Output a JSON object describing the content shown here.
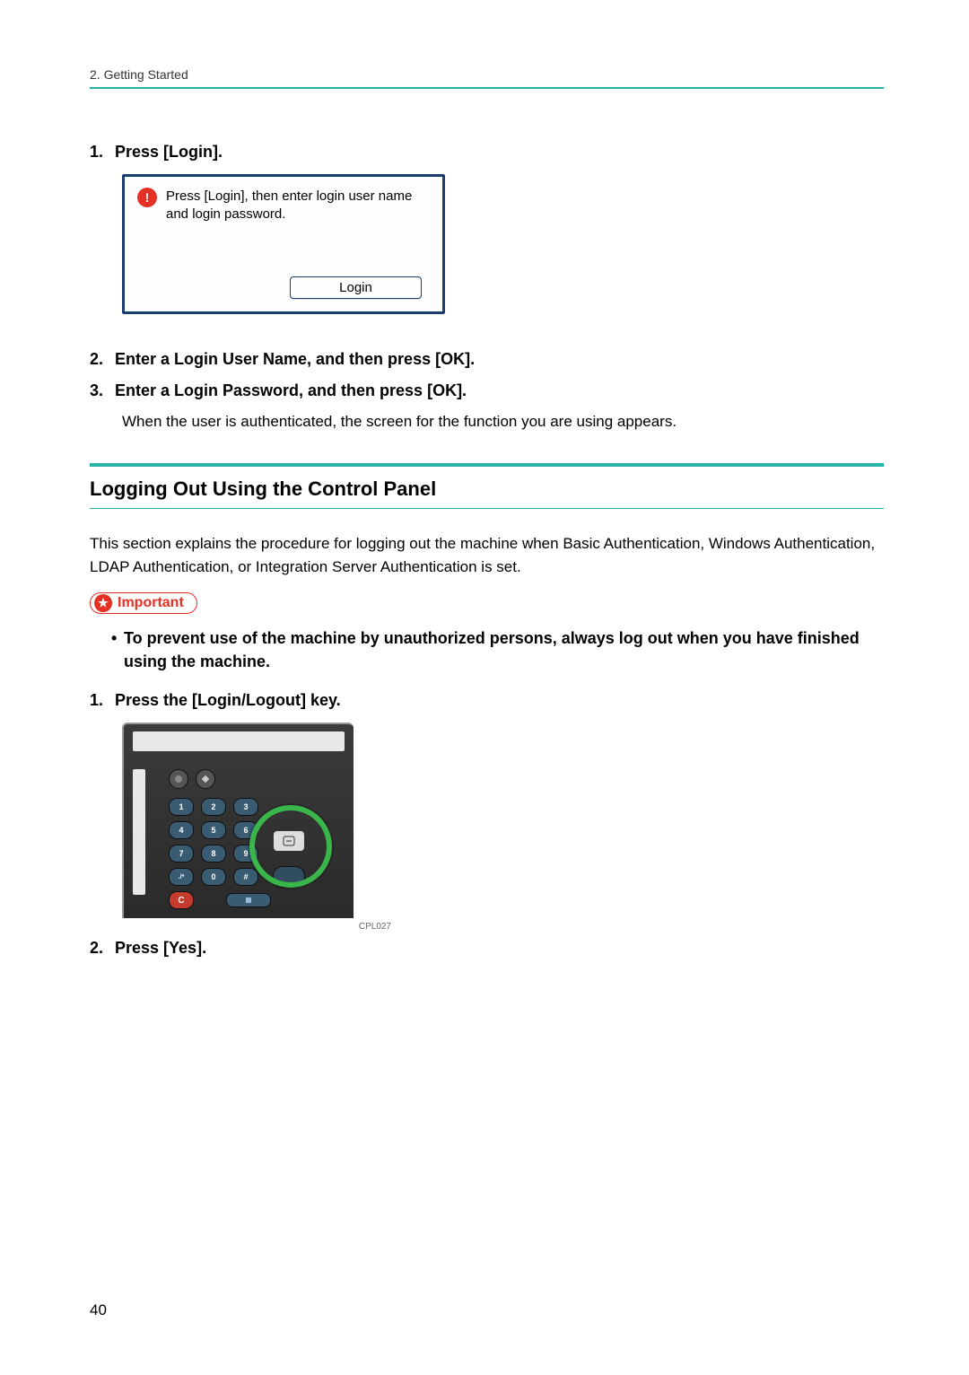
{
  "header": {
    "chapter": "2. Getting Started"
  },
  "login_steps": {
    "step1": {
      "num": "1.",
      "text": "Press [Login]."
    },
    "panel": {
      "message": "Press [Login], then enter login user name and login password.",
      "button": "Login"
    },
    "step2": {
      "num": "2.",
      "text": "Enter a Login User Name, and then press [OK]."
    },
    "step3": {
      "num": "3.",
      "text": "Enter a Login Password, and then press [OK]."
    },
    "followup": "When the user is authenticated, the screen for the function you are using appears."
  },
  "section": {
    "title": "Logging Out Using the Control Panel",
    "intro": "This section explains the procedure for logging out the machine when Basic Authentication, Windows Authentication, LDAP Authentication, or Integration Server Authentication is set.",
    "important_label": "Important",
    "important_text": "To prevent use of the machine by unauthorized persons, always log out when you have finished using the machine.",
    "step1": {
      "num": "1.",
      "text": "Press the [Login/Logout] key."
    },
    "figure_caption": "CPL027",
    "step2": {
      "num": "2.",
      "text": "Press [Yes]."
    }
  },
  "keypad": {
    "r1": [
      "1",
      "2",
      "3"
    ],
    "r2": [
      "4",
      "5",
      "6"
    ],
    "r3": [
      "7",
      "8",
      "9"
    ],
    "r4": [
      "./*",
      "0",
      "#"
    ],
    "clear": "C"
  },
  "page_number": "40"
}
